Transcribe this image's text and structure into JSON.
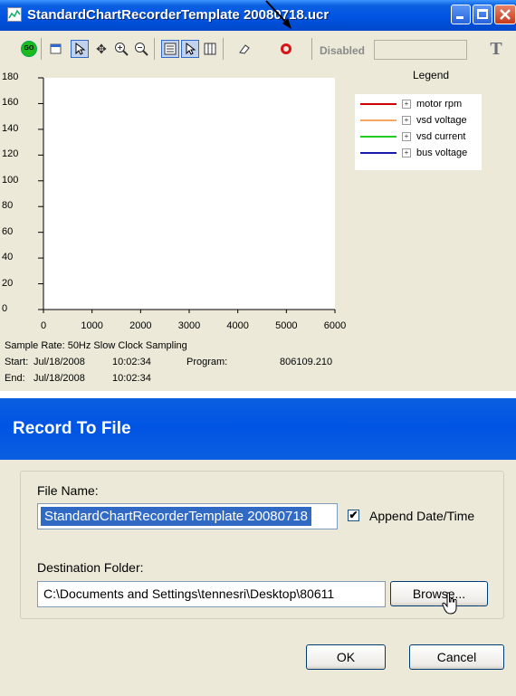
{
  "window": {
    "title": "StandardChartRecorderTemplate 20080718.ucr"
  },
  "toolbar": {
    "icons": [
      "go-icon",
      "properties-icon",
      "select-icon",
      "move-icon",
      "zoom-in-icon",
      "zoom-out-icon",
      "legend-icon",
      "cursor-icon",
      "columns-icon",
      "eraser-icon",
      "record-icon"
    ],
    "status_label": "Disabled",
    "status_value": ""
  },
  "chart_data": {
    "type": "line",
    "title": "",
    "xlabel": "",
    "ylabel": "",
    "xlim": [
      0,
      6000
    ],
    "ylim": [
      0,
      180
    ],
    "x_ticks": [
      "0",
      "1000",
      "2000",
      "3000",
      "4000",
      "5000",
      "6000"
    ],
    "y_ticks": [
      "180",
      "160",
      "140",
      "120",
      "100",
      "80",
      "60",
      "40",
      "20",
      "0"
    ],
    "legend_title": "Legend",
    "series": [
      {
        "name": "motor rpm",
        "color": "#CC0000",
        "values": []
      },
      {
        "name": "vsd voltage",
        "color": "#F5A860",
        "values": []
      },
      {
        "name": "vsd current",
        "color": "#22CC22",
        "values": []
      },
      {
        "name": "bus voltage",
        "color": "#1A1AAA",
        "values": []
      }
    ]
  },
  "chart_info": {
    "sample_rate": "Sample Rate:  50Hz Slow Clock Sampling",
    "start_label": "Start:",
    "start_date": "Jul/18/2008",
    "start_time": "10:02:34",
    "program_label": "Program:",
    "program_value": "806109.210",
    "end_label": "End:",
    "end_date": "Jul/18/2008",
    "end_time": "10:02:34"
  },
  "dialog": {
    "title": "Record To File",
    "file_name_label": "File Name:",
    "file_name_value": "StandardChartRecorderTemplate 20080718",
    "append_label": "Append Date/Time",
    "append_checked": true,
    "destination_label": "Destination Folder:",
    "destination_value": "C:\\Documents and Settings\\tennesri\\Desktop\\80611",
    "browse_label": "Browse...",
    "ok_label": "OK",
    "cancel_label": "Cancel"
  }
}
